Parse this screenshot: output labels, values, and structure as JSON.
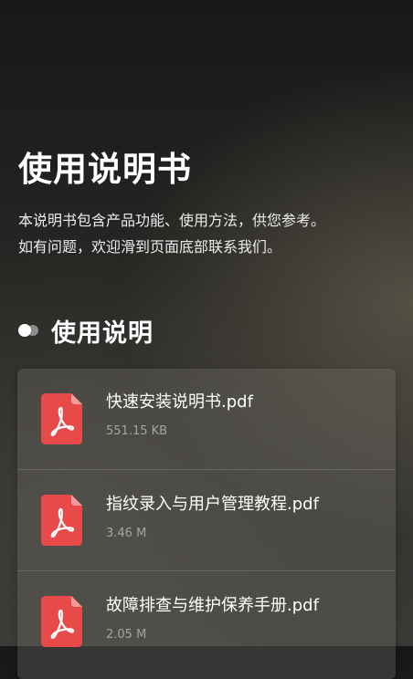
{
  "header": {
    "title": "使用说明书",
    "intro_line1": "本说明书包含产品功能、使用方法，供您参考。",
    "intro_line2": "如有问题，欢迎滑到页面底部联系我们。"
  },
  "section": {
    "title": "使用说明",
    "icon": "toggle-dots-icon"
  },
  "files": [
    {
      "name": "快速安装说明书.pdf",
      "size": "551.15 KB",
      "icon": "pdf-icon"
    },
    {
      "name": "指纹录入与用户管理教程.pdf",
      "size": "3.46 M",
      "icon": "pdf-icon"
    },
    {
      "name": "故障排查与维护保养手册.pdf",
      "size": "2.05 M",
      "icon": "pdf-icon"
    }
  ],
  "colors": {
    "pdf_icon": "#e84a4a",
    "pdf_fold": "#f59a9a",
    "secondary_text": "#a4a4a0"
  }
}
